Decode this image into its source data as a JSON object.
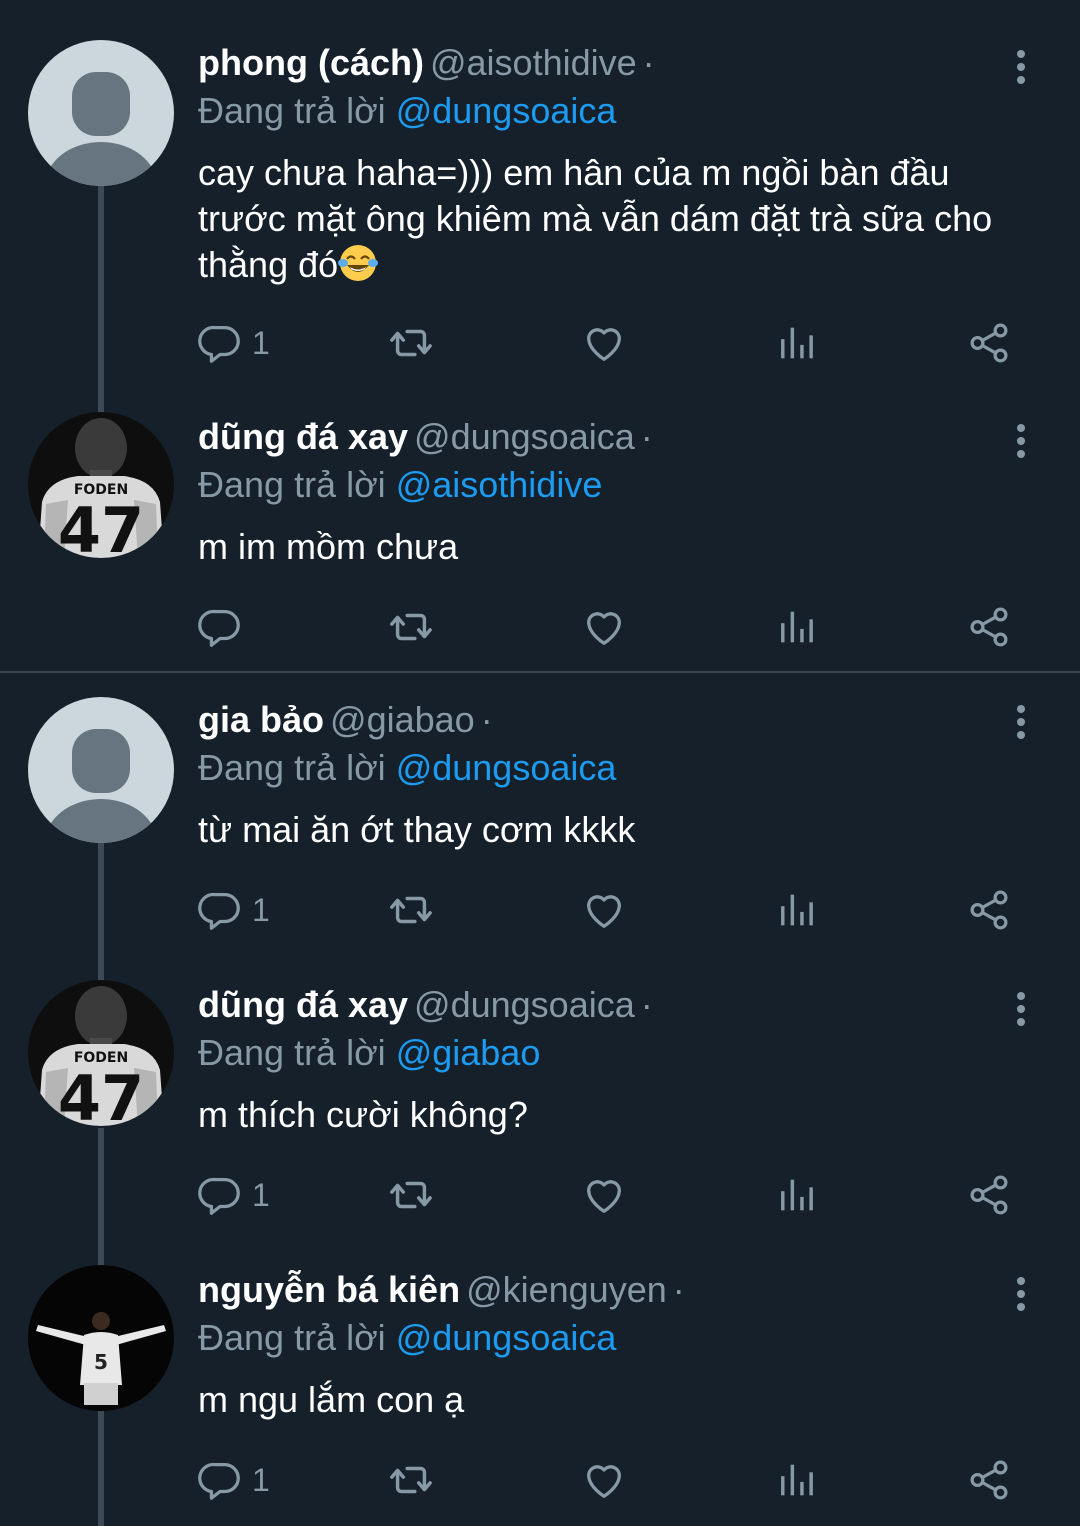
{
  "theme": {
    "background": "#15202b",
    "text": "#ffffff",
    "muted": "#8899a6",
    "accent": "#1d9bf0"
  },
  "tweets": [
    {
      "name": "phong (cách)",
      "handle": "@aisothidive",
      "dot": "·",
      "reply_label": "Đang trả lời",
      "reply_to": "@dungsoaica",
      "text": "cay chưa haha=))) em hân của m ngồi bàn đầu trước mặt ông khiêm mà vẫn dám đặt trà sữa cho thằng đó",
      "emoji": "face-with-tears-of-joy",
      "reply_count": "1",
      "avatar": "default-avatar"
    },
    {
      "name": "dũng đá xay",
      "handle": "@dungsoaica",
      "dot": "·",
      "reply_label": "Đang trả lời",
      "reply_to": "@aisothidive",
      "text": "m im mồm chưa",
      "reply_count": "",
      "avatar": "jersey-avatar",
      "avatar_text": {
        "name": "FODEN",
        "number": "47"
      }
    },
    {
      "name": "gia bảo",
      "handle": "@giabao",
      "dot": "·",
      "reply_label": "Đang trả lời",
      "reply_to": "@dungsoaica",
      "text": "từ mai ăn ớt thay cơm kkkk",
      "reply_count": "1",
      "avatar": "default-avatar"
    },
    {
      "name": "dũng đá xay",
      "handle": "@dungsoaica",
      "dot": "·",
      "reply_label": "Đang trả lời",
      "reply_to": "@giabao",
      "text": "m thích cười không?",
      "reply_count": "1",
      "avatar": "jersey-avatar",
      "avatar_text": {
        "name": "FODEN",
        "number": "47"
      }
    },
    {
      "name": "nguyễn bá kiên",
      "handle": "@kienguyen",
      "dot": "·",
      "reply_label": "Đang trả lời",
      "reply_to": "@dungsoaica",
      "text": "m ngu lắm con ạ",
      "reply_count": "1",
      "avatar": "player-celebration-avatar",
      "avatar_text": {
        "number": "5"
      }
    }
  ],
  "icons": [
    "reply-icon",
    "retweet-icon",
    "like-icon",
    "views-icon",
    "share-icon",
    "more-icon"
  ]
}
